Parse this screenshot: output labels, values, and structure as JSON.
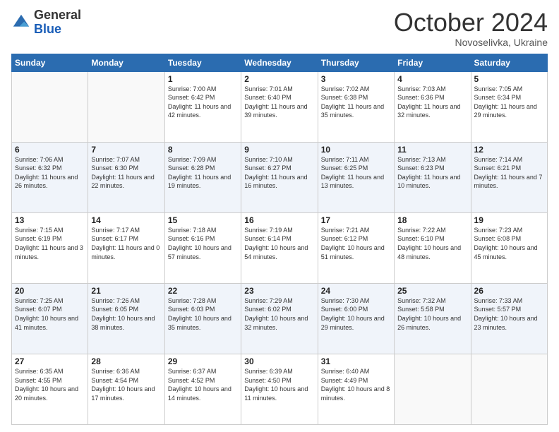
{
  "header": {
    "logo_general": "General",
    "logo_blue": "Blue",
    "month_title": "October 2024",
    "location": "Novoselivka, Ukraine"
  },
  "days_of_week": [
    "Sunday",
    "Monday",
    "Tuesday",
    "Wednesday",
    "Thursday",
    "Friday",
    "Saturday"
  ],
  "weeks": [
    [
      {
        "day": "",
        "sunrise": "",
        "sunset": "",
        "daylight": ""
      },
      {
        "day": "",
        "sunrise": "",
        "sunset": "",
        "daylight": ""
      },
      {
        "day": "1",
        "sunrise": "Sunrise: 7:00 AM",
        "sunset": "Sunset: 6:42 PM",
        "daylight": "Daylight: 11 hours and 42 minutes."
      },
      {
        "day": "2",
        "sunrise": "Sunrise: 7:01 AM",
        "sunset": "Sunset: 6:40 PM",
        "daylight": "Daylight: 11 hours and 39 minutes."
      },
      {
        "day": "3",
        "sunrise": "Sunrise: 7:02 AM",
        "sunset": "Sunset: 6:38 PM",
        "daylight": "Daylight: 11 hours and 35 minutes."
      },
      {
        "day": "4",
        "sunrise": "Sunrise: 7:03 AM",
        "sunset": "Sunset: 6:36 PM",
        "daylight": "Daylight: 11 hours and 32 minutes."
      },
      {
        "day": "5",
        "sunrise": "Sunrise: 7:05 AM",
        "sunset": "Sunset: 6:34 PM",
        "daylight": "Daylight: 11 hours and 29 minutes."
      }
    ],
    [
      {
        "day": "6",
        "sunrise": "Sunrise: 7:06 AM",
        "sunset": "Sunset: 6:32 PM",
        "daylight": "Daylight: 11 hours and 26 minutes."
      },
      {
        "day": "7",
        "sunrise": "Sunrise: 7:07 AM",
        "sunset": "Sunset: 6:30 PM",
        "daylight": "Daylight: 11 hours and 22 minutes."
      },
      {
        "day": "8",
        "sunrise": "Sunrise: 7:09 AM",
        "sunset": "Sunset: 6:28 PM",
        "daylight": "Daylight: 11 hours and 19 minutes."
      },
      {
        "day": "9",
        "sunrise": "Sunrise: 7:10 AM",
        "sunset": "Sunset: 6:27 PM",
        "daylight": "Daylight: 11 hours and 16 minutes."
      },
      {
        "day": "10",
        "sunrise": "Sunrise: 7:11 AM",
        "sunset": "Sunset: 6:25 PM",
        "daylight": "Daylight: 11 hours and 13 minutes."
      },
      {
        "day": "11",
        "sunrise": "Sunrise: 7:13 AM",
        "sunset": "Sunset: 6:23 PM",
        "daylight": "Daylight: 11 hours and 10 minutes."
      },
      {
        "day": "12",
        "sunrise": "Sunrise: 7:14 AM",
        "sunset": "Sunset: 6:21 PM",
        "daylight": "Daylight: 11 hours and 7 minutes."
      }
    ],
    [
      {
        "day": "13",
        "sunrise": "Sunrise: 7:15 AM",
        "sunset": "Sunset: 6:19 PM",
        "daylight": "Daylight: 11 hours and 3 minutes."
      },
      {
        "day": "14",
        "sunrise": "Sunrise: 7:17 AM",
        "sunset": "Sunset: 6:17 PM",
        "daylight": "Daylight: 11 hours and 0 minutes."
      },
      {
        "day": "15",
        "sunrise": "Sunrise: 7:18 AM",
        "sunset": "Sunset: 6:16 PM",
        "daylight": "Daylight: 10 hours and 57 minutes."
      },
      {
        "day": "16",
        "sunrise": "Sunrise: 7:19 AM",
        "sunset": "Sunset: 6:14 PM",
        "daylight": "Daylight: 10 hours and 54 minutes."
      },
      {
        "day": "17",
        "sunrise": "Sunrise: 7:21 AM",
        "sunset": "Sunset: 6:12 PM",
        "daylight": "Daylight: 10 hours and 51 minutes."
      },
      {
        "day": "18",
        "sunrise": "Sunrise: 7:22 AM",
        "sunset": "Sunset: 6:10 PM",
        "daylight": "Daylight: 10 hours and 48 minutes."
      },
      {
        "day": "19",
        "sunrise": "Sunrise: 7:23 AM",
        "sunset": "Sunset: 6:08 PM",
        "daylight": "Daylight: 10 hours and 45 minutes."
      }
    ],
    [
      {
        "day": "20",
        "sunrise": "Sunrise: 7:25 AM",
        "sunset": "Sunset: 6:07 PM",
        "daylight": "Daylight: 10 hours and 41 minutes."
      },
      {
        "day": "21",
        "sunrise": "Sunrise: 7:26 AM",
        "sunset": "Sunset: 6:05 PM",
        "daylight": "Daylight: 10 hours and 38 minutes."
      },
      {
        "day": "22",
        "sunrise": "Sunrise: 7:28 AM",
        "sunset": "Sunset: 6:03 PM",
        "daylight": "Daylight: 10 hours and 35 minutes."
      },
      {
        "day": "23",
        "sunrise": "Sunrise: 7:29 AM",
        "sunset": "Sunset: 6:02 PM",
        "daylight": "Daylight: 10 hours and 32 minutes."
      },
      {
        "day": "24",
        "sunrise": "Sunrise: 7:30 AM",
        "sunset": "Sunset: 6:00 PM",
        "daylight": "Daylight: 10 hours and 29 minutes."
      },
      {
        "day": "25",
        "sunrise": "Sunrise: 7:32 AM",
        "sunset": "Sunset: 5:58 PM",
        "daylight": "Daylight: 10 hours and 26 minutes."
      },
      {
        "day": "26",
        "sunrise": "Sunrise: 7:33 AM",
        "sunset": "Sunset: 5:57 PM",
        "daylight": "Daylight: 10 hours and 23 minutes."
      }
    ],
    [
      {
        "day": "27",
        "sunrise": "Sunrise: 6:35 AM",
        "sunset": "Sunset: 4:55 PM",
        "daylight": "Daylight: 10 hours and 20 minutes."
      },
      {
        "day": "28",
        "sunrise": "Sunrise: 6:36 AM",
        "sunset": "Sunset: 4:54 PM",
        "daylight": "Daylight: 10 hours and 17 minutes."
      },
      {
        "day": "29",
        "sunrise": "Sunrise: 6:37 AM",
        "sunset": "Sunset: 4:52 PM",
        "daylight": "Daylight: 10 hours and 14 minutes."
      },
      {
        "day": "30",
        "sunrise": "Sunrise: 6:39 AM",
        "sunset": "Sunset: 4:50 PM",
        "daylight": "Daylight: 10 hours and 11 minutes."
      },
      {
        "day": "31",
        "sunrise": "Sunrise: 6:40 AM",
        "sunset": "Sunset: 4:49 PM",
        "daylight": "Daylight: 10 hours and 8 minutes."
      },
      {
        "day": "",
        "sunrise": "",
        "sunset": "",
        "daylight": ""
      },
      {
        "day": "",
        "sunrise": "",
        "sunset": "",
        "daylight": ""
      }
    ]
  ]
}
